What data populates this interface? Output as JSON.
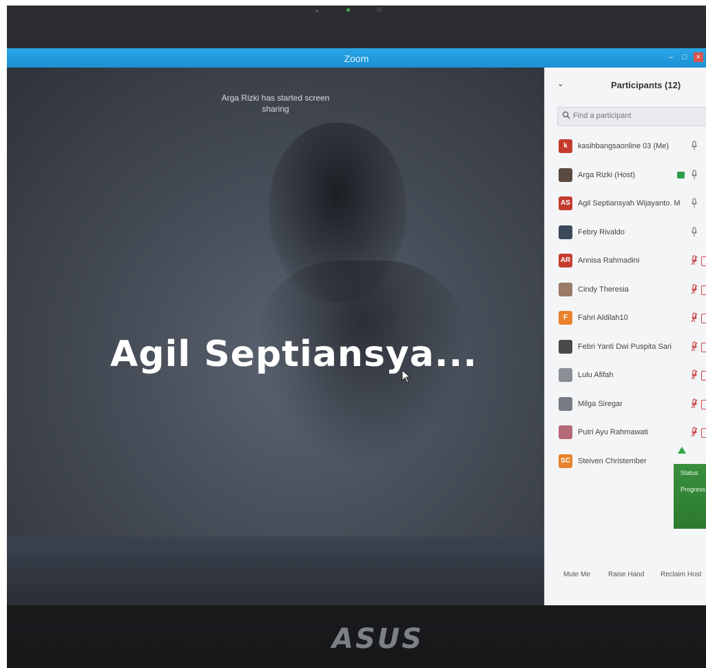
{
  "window": {
    "title": "Zoom"
  },
  "share": {
    "notice": "Arga Rizki has started screen sharing",
    "speaker_name": "Agil  Septiansya..."
  },
  "participants_panel": {
    "title": "Participants (12)",
    "search_placeholder": "Find a participant",
    "participants": [
      {
        "name": "kasihbangsaonline 03 (Me)",
        "avatar_letter": "k",
        "avatar_color": "#c43b2e",
        "avatar_type": "letter",
        "mic": "on",
        "sharing": false
      },
      {
        "name": "Arga Rizki (Host)",
        "avatar_letter": "",
        "avatar_color": "#5a4a3f",
        "avatar_type": "photo",
        "mic": "on",
        "sharing": true
      },
      {
        "name": "Agil Septiansyah Wijayanto. M",
        "avatar_letter": "AS",
        "avatar_color": "#c43b2e",
        "avatar_type": "letter",
        "mic": "on",
        "sharing": false
      },
      {
        "name": "Febry Rivaldo",
        "avatar_letter": "",
        "avatar_color": "#3d4a5c",
        "avatar_type": "photo",
        "mic": "on",
        "sharing": false
      },
      {
        "name": "Annisa Rahmadini",
        "avatar_letter": "AR",
        "avatar_color": "#c43b2e",
        "avatar_type": "letter",
        "mic": "muted",
        "sharing": false
      },
      {
        "name": "Cindy Theresia",
        "avatar_letter": "",
        "avatar_color": "#9a7b68",
        "avatar_type": "photo",
        "mic": "muted",
        "sharing": false
      },
      {
        "name": "Fahri Aldilah10",
        "avatar_letter": "F",
        "avatar_color": "#e8822c",
        "avatar_type": "letter",
        "mic": "muted",
        "sharing": false
      },
      {
        "name": "Febri Yanti Dwi Puspita Sari",
        "avatar_letter": "",
        "avatar_color": "#4a4a4a",
        "avatar_type": "photo",
        "mic": "muted",
        "sharing": false
      },
      {
        "name": "Lulu Afifah",
        "avatar_letter": "",
        "avatar_color": "#8a8f96",
        "avatar_type": "photo",
        "mic": "muted",
        "sharing": false
      },
      {
        "name": "Milga Siregar",
        "avatar_letter": "",
        "avatar_color": "#777c84",
        "avatar_type": "photo",
        "mic": "muted",
        "sharing": false
      },
      {
        "name": "Putri Ayu Rahmawati",
        "avatar_letter": "",
        "avatar_color": "#b56a7a",
        "avatar_type": "photo",
        "mic": "muted",
        "sharing": false
      },
      {
        "name": "Steiven Christember",
        "avatar_letter": "SC",
        "avatar_color": "#e8822c",
        "avatar_type": "letter",
        "mic": "none",
        "sharing": false
      }
    ],
    "status_tile": {
      "status_label": "Status",
      "progress_label": "Progress",
      "color": "#2c7a30"
    },
    "footer": {
      "mute_me": "Mute Me",
      "raise_hand": "Raise Hand",
      "reclaim_host": "Reclaim Host"
    }
  },
  "device_brand": "ASUS",
  "colors": {
    "titlebar": "#1c8fd1",
    "mic_on": "#777777",
    "mic_muted": "#c94040"
  }
}
